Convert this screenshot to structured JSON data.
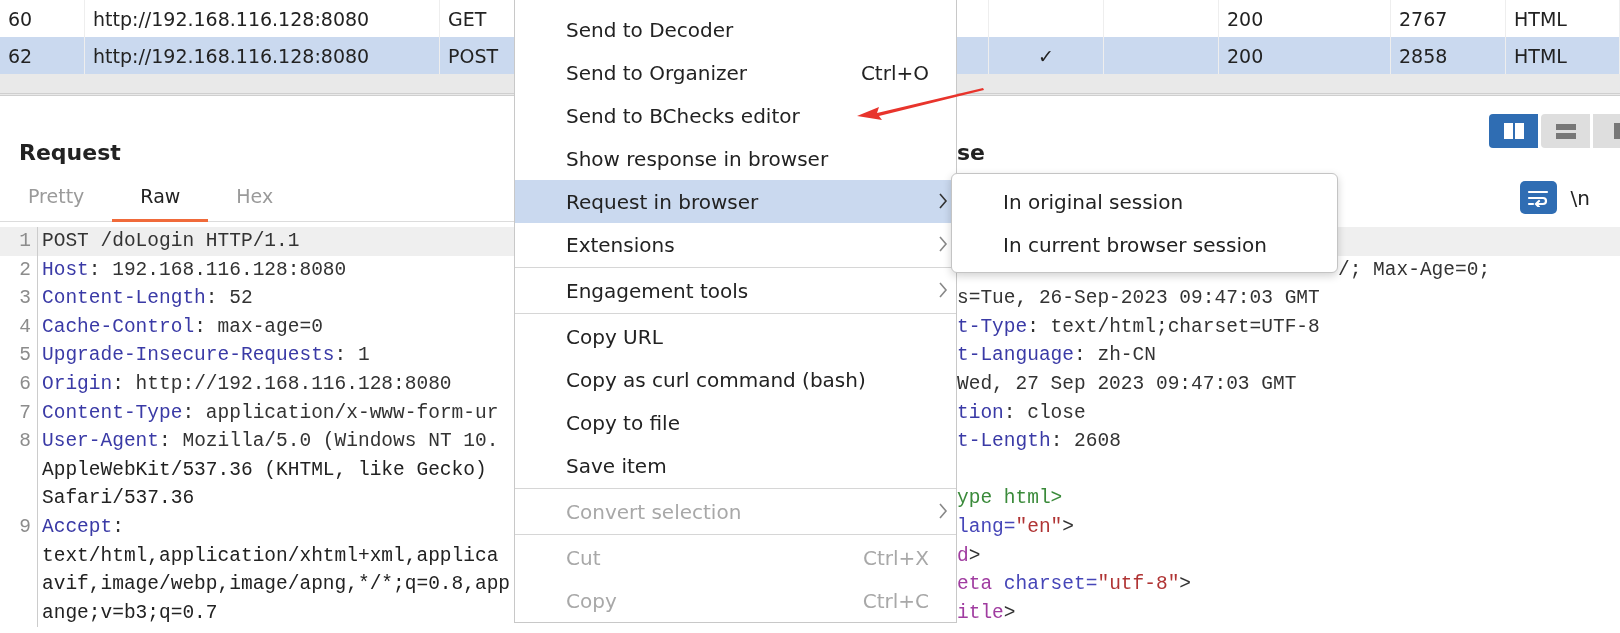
{
  "table": {
    "rows": [
      {
        "selected": false,
        "column_1": "60",
        "column_2": "http://192.168.116.128:8080",
        "column_3": "GET",
        "column_6": "200",
        "column_7": "2767",
        "column_8": "HTML"
      },
      {
        "selected": true,
        "column_1": "62",
        "column_2": "http://192.168.116.128:8080",
        "column_3": "POST",
        "column_4": "✓",
        "column_6": "200",
        "column_7": "2858",
        "column_8": "HTML"
      }
    ]
  },
  "request": {
    "title": "Request",
    "tabs": [
      {
        "label": "Pretty",
        "selected": false
      },
      {
        "label": "Raw",
        "selected": true
      },
      {
        "label": "Hex",
        "selected": false
      }
    ],
    "lines": [
      {
        "number": "1",
        "highlighted": true,
        "parts": [
          {
            "kind": "text",
            "text": "POST /doLogin HTTP/1.1"
          }
        ]
      },
      {
        "number": "2",
        "highlighted": false,
        "parts": [
          {
            "kind": "key",
            "text": "Host"
          },
          {
            "kind": "text",
            "text": ": 192.168.116.128:8080"
          }
        ]
      },
      {
        "number": "3",
        "highlighted": false,
        "parts": [
          {
            "kind": "key",
            "text": "Content-Length"
          },
          {
            "kind": "text",
            "text": ": 52"
          }
        ]
      },
      {
        "number": "4",
        "highlighted": false,
        "parts": [
          {
            "kind": "key",
            "text": "Cache-Control"
          },
          {
            "kind": "text",
            "text": ": max-age=0"
          }
        ]
      },
      {
        "number": "5",
        "highlighted": false,
        "parts": [
          {
            "kind": "key",
            "text": "Upgrade-Insecure-Requests"
          },
          {
            "kind": "text",
            "text": ": 1"
          }
        ]
      },
      {
        "number": "6",
        "highlighted": false,
        "parts": [
          {
            "kind": "key",
            "text": "Origin"
          },
          {
            "kind": "text",
            "text": ": http://192.168.116.128:8080"
          }
        ]
      },
      {
        "number": "7",
        "highlighted": false,
        "parts": [
          {
            "kind": "key",
            "text": "Content-Type"
          },
          {
            "kind": "text",
            "text": ": application/x-www-form-ur"
          }
        ]
      },
      {
        "number": "8",
        "highlighted": false,
        "parts": [
          {
            "kind": "key",
            "text": "User-Agent"
          },
          {
            "kind": "text",
            "text": ": Mozilla/5.0 (Windows NT 10."
          }
        ],
        "wrapped": [
          "AppleWebKit/537.36 (KHTML, like Gecko)",
          "Safari/537.36"
        ]
      },
      {
        "number": "9",
        "highlighted": false,
        "parts": [
          {
            "kind": "key",
            "text": "Accept"
          },
          {
            "kind": "text",
            "text": ":"
          }
        ],
        "wrapped": [
          "text/html,application/xhtml+xml,applica",
          "avif,image/webp,image/apng,*/*;q=0.8,app",
          "ange;v=b3;q=0.7"
        ]
      }
    ]
  },
  "response": {
    "title": "se",
    "layout_buttons": [
      {
        "kind": "columns",
        "selected": true
      },
      {
        "kind": "rows",
        "selected": false
      },
      {
        "kind": "side",
        "selected": false
      }
    ],
    "wrap_button": {
      "on": true
    },
    "newline_toggle": "\\n",
    "lines": [
      {
        "highlighted": true
      },
      {
        "highlighted": false,
        "covered_start": true,
        "parts": [
          {
            "kind": "text",
            "text": "/; Max-Age=0;"
          }
        ]
      },
      {
        "highlighted": false,
        "parts": [
          {
            "kind": "text",
            "text": "s=Tue, 26-Sep-2023 09:47:03 GMT"
          }
        ]
      },
      {
        "highlighted": false,
        "parts": [
          {
            "kind": "key",
            "text": "t-Type"
          },
          {
            "kind": "text",
            "text": ": text/html;charset=UTF-8"
          }
        ]
      },
      {
        "highlighted": false,
        "parts": [
          {
            "kind": "key",
            "text": "t-Language"
          },
          {
            "kind": "text",
            "text": ": zh-CN"
          }
        ]
      },
      {
        "highlighted": false,
        "parts": [
          {
            "kind": "text",
            "text": "Wed, 27 Sep 2023 09:47:03 GMT"
          }
        ]
      },
      {
        "highlighted": false,
        "parts": [
          {
            "kind": "key",
            "text": "tion"
          },
          {
            "kind": "text",
            "text": ": close"
          }
        ]
      },
      {
        "highlighted": false,
        "parts": [
          {
            "kind": "key",
            "text": "t-Length"
          },
          {
            "kind": "text",
            "text": ": 2608"
          }
        ]
      },
      {
        "highlighted": false
      },
      {
        "highlighted": false,
        "parts": [
          {
            "kind": "tag",
            "text": "ype html>"
          }
        ]
      },
      {
        "highlighted": false,
        "parts": [
          {
            "kind": "attr",
            "text": "lang="
          },
          {
            "kind": "string",
            "text": "\"en\""
          },
          {
            "kind": "text",
            "text": ">"
          }
        ]
      },
      {
        "highlighted": false,
        "parts": [
          {
            "kind": "element",
            "text": "d"
          },
          {
            "kind": "text",
            "text": ">"
          }
        ]
      },
      {
        "highlighted": false,
        "parts": [
          {
            "kind": "element",
            "text": "eta"
          },
          {
            "kind": "attr",
            "text": " charset="
          },
          {
            "kind": "string",
            "text": "\"utf-8\""
          },
          {
            "kind": "text",
            "text": ">"
          }
        ]
      },
      {
        "highlighted": false,
        "parts": [
          {
            "kind": "element",
            "text": "itle"
          },
          {
            "kind": "text",
            "text": ">"
          }
        ]
      }
    ]
  },
  "menu": {
    "groups": [
      {
        "items": [
          {
            "label": "Send to Decoder",
            "disabled": false,
            "selected": false,
            "has_submenu": false
          },
          {
            "label": "Send to Organizer",
            "shortcut": "Ctrl+O",
            "disabled": false,
            "selected": false,
            "has_submenu": false
          },
          {
            "label": "Send to BChecks editor",
            "disabled": false,
            "selected": false,
            "has_submenu": false
          },
          {
            "label": "Show response in browser",
            "disabled": false,
            "selected": false,
            "has_submenu": false
          },
          {
            "label": "Request in browser",
            "disabled": false,
            "selected": true,
            "has_submenu": true,
            "expanded": true,
            "children": [
              {
                "label": "In original session"
              },
              {
                "label": "In current browser session"
              }
            ]
          },
          {
            "label": "Extensions",
            "disabled": false,
            "selected": false,
            "has_submenu": true,
            "expanded": false
          }
        ]
      },
      {
        "items": [
          {
            "label": "Engagement tools",
            "disabled": false,
            "selected": false,
            "has_submenu": true,
            "expanded": false
          }
        ]
      },
      {
        "items": [
          {
            "label": "Copy URL",
            "disabled": false,
            "selected": false,
            "has_submenu": false
          },
          {
            "label": "Copy as curl command (bash)",
            "disabled": false,
            "selected": false,
            "has_submenu": false
          },
          {
            "label": "Copy to file",
            "disabled": false,
            "selected": false,
            "has_submenu": false
          },
          {
            "label": "Save item",
            "disabled": false,
            "selected": false,
            "has_submenu": false
          }
        ]
      },
      {
        "items": [
          {
            "label": "Convert selection",
            "disabled": true,
            "selected": false,
            "has_submenu": true,
            "expanded": false
          }
        ]
      },
      {
        "items": [
          {
            "label": "Cut",
            "shortcut": "Ctrl+X",
            "disabled": true,
            "selected": false,
            "has_submenu": false
          },
          {
            "label": "Copy",
            "shortcut": "Ctrl+C",
            "disabled": true,
            "selected": false,
            "has_submenu": false
          }
        ]
      }
    ]
  },
  "annotation": {
    "kind": "arrow"
  }
}
